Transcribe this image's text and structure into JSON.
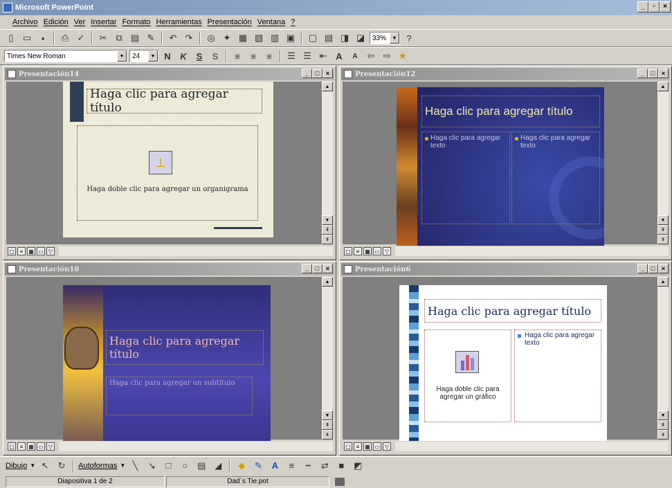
{
  "app": {
    "title": "Microsoft PowerPoint"
  },
  "menu": [
    "Archivo",
    "Edición",
    "Ver",
    "Insertar",
    "Formato",
    "Herramientas",
    "Presentación",
    "Ventana",
    "?"
  ],
  "toolbar": {
    "font": "Times New Roman",
    "size": "24",
    "zoom": "33%",
    "bold": "N",
    "italic": "K",
    "underline": "S",
    "shadow": "S"
  },
  "windows": [
    {
      "title": "Presentación14",
      "slide_title": "Haga clic para agregar título",
      "body": "Haga doble clic para agregar un organigrama"
    },
    {
      "title": "Presentación12",
      "slide_title": "Haga clic para agregar título",
      "col1": "Haga clic para agregar texto",
      "col2": "Haga clic para agregar texto"
    },
    {
      "title": "Presentación10",
      "slide_title": "Haga clic para agregar título",
      "subtitle": "Haga clic para agregar un subtítulo"
    },
    {
      "title": "Presentación6",
      "slide_title": "Haga clic para agregar título",
      "chart_text": "Haga doble clic para agregar un gráfico",
      "bullet": "Haga clic para agregar texto"
    }
  ],
  "drawing": {
    "draw_label": "Dibujo",
    "autoshapes_label": "Autoformas"
  },
  "status": {
    "slide": "Diapositiva 1 de 2",
    "template": "Dad`s Tie.pot"
  },
  "colors": {
    "title_bar": "#7c93b8",
    "window_title": "#8d8d8d",
    "slide12_bg": "#2a2a78",
    "slide10_bg": "#3a3a9a",
    "accent_yellow": "#f0c000"
  }
}
